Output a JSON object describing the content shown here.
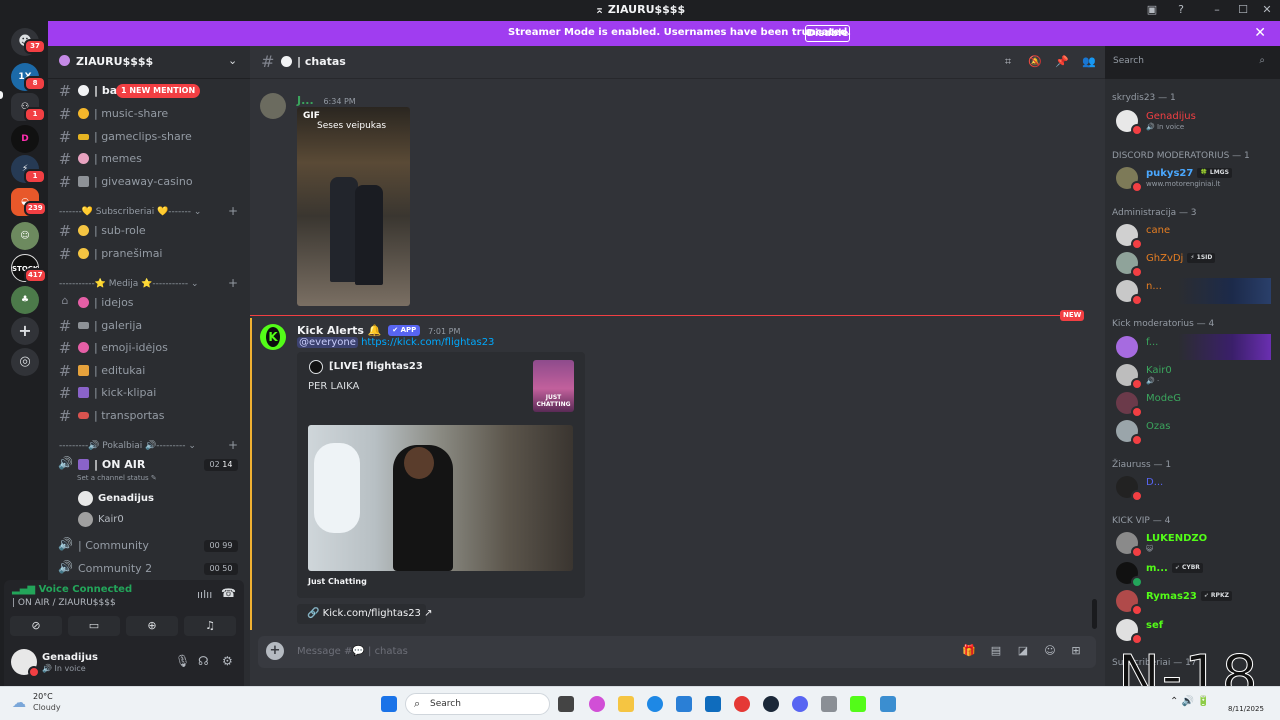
{
  "app": {
    "window_title": "ZIAURU$$$$",
    "banner_text": "Streamer Mode is enabled. Usernames have been truncated.",
    "banner_button": "Disable"
  },
  "server_rail": {
    "badges": [
      "37",
      "8",
      "1",
      "1",
      "239",
      "417"
    ]
  },
  "guild": {
    "name": "ZIAURU$$$$",
    "new_mention": "1 NEW MENTION",
    "channels_top": [
      {
        "label": "| ba"
      },
      {
        "label": "| music-share"
      },
      {
        "label": "| gameclips-share"
      },
      {
        "label": "| memes"
      },
      {
        "label": "| giveaway-casino"
      }
    ],
    "category_subscribers": "-------💛 Subscriberiai 💛------- ⌄",
    "channels_sub": [
      {
        "label": "| sub-role"
      },
      {
        "label": "| pranešimai"
      }
    ],
    "category_media": "-----------⭐ Medija ⭐----------- ⌄",
    "channels_media": [
      {
        "label": "| idejos"
      },
      {
        "label": "| galerija"
      },
      {
        "label": "| emoji-idėjos"
      },
      {
        "label": "| editukai"
      },
      {
        "label": "| kick-klipai"
      },
      {
        "label": "| transportas"
      }
    ],
    "category_voice": "---------🔊 Pokalbiai 🔊--------- ⌄",
    "voice_on_air": {
      "label": "| ON AIR",
      "count_a": "02",
      "count_b": "14",
      "status": "Set a channel status ✎"
    },
    "voice_users": [
      "Genadijus",
      "Kair0"
    ],
    "voice_community": {
      "label": "| Community",
      "count_a": "00",
      "count_b": "99"
    },
    "voice_community2": {
      "label": "Community 2",
      "count_a": "00",
      "count_b": "50"
    }
  },
  "voice_panel": {
    "status": "Voice Connected",
    "location": "| ON AIR / ZIAURU$$$$"
  },
  "user_panel": {
    "name": "Genadijus",
    "status": "In voice"
  },
  "chat": {
    "channel_name": "| chatas",
    "message_placeholder": "Message #💬 | chatas",
    "messages": [
      {
        "author": "J...",
        "time": "6:34 PM",
        "gif_tag": "GIF",
        "gif_caption": "Seses veipukas"
      },
      {
        "author": "Kick Alerts 🔔",
        "app_tag": "✔ APP",
        "time": "7:01 PM",
        "mention": "@everyone",
        "link": "https://kick.com/flightas23",
        "embed_title": "[LIVE] flightas23",
        "embed_desc": "PER LAIKA",
        "embed_thumb_text": "JUST CHATTING",
        "embed_footer": "Just Chatting",
        "link_button": "Kick.com/flightas23"
      }
    ],
    "new_label": "NEW"
  },
  "search": {
    "placeholder": "Search"
  },
  "members": {
    "groups": [
      {
        "title": "skrydis23 — 1",
        "members": [
          {
            "name": "Genadijus",
            "sub": "🔊 In voice",
            "color": "#f23f43"
          }
        ]
      },
      {
        "title": "DISCORD MODERATORIUS — 1",
        "members": [
          {
            "name": "pukys27",
            "tag": "🍀 LMGS",
            "sub": "www.motorenginiai.lt",
            "color": "#4aa8ff"
          }
        ]
      },
      {
        "title": "Administracija — 3",
        "members": [
          {
            "name": "cane",
            "color": "#e67e22"
          },
          {
            "name": "GhZvDj",
            "tag": "⚡ 1SID",
            "color": "#e67e22"
          },
          {
            "name": "n...",
            "color": "#e67e22"
          }
        ]
      },
      {
        "title": "Kick moderatorius — 4",
        "members": [
          {
            "name": "f...",
            "color": "#3ba55d"
          },
          {
            "name": "Kair0",
            "sub": "🔊 ·",
            "color": "#3ba55d"
          },
          {
            "name": "ModeG",
            "color": "#3ba55d"
          },
          {
            "name": "Ozas",
            "color": "#3ba55d"
          }
        ]
      },
      {
        "title": "Žiauruss — 1",
        "members": [
          {
            "name": "D...",
            "color": "#5865f2"
          }
        ]
      },
      {
        "title": "KICK VIP — 4",
        "members": [
          {
            "name": "LUKENDZO",
            "sub": "😺",
            "color": "#53fc18"
          },
          {
            "name": "m...",
            "tag": "➶ CYBR",
            "color": "#53fc18"
          },
          {
            "name": "Rymas23",
            "tag": "➶ RPKZ",
            "color": "#53fc18"
          },
          {
            "name": "sef",
            "color": "#53fc18"
          }
        ]
      }
    ],
    "partial_group": "Subscriberiai — 17"
  },
  "taskbar": {
    "weather_temp": "20°C",
    "weather_desc": "Cloudy",
    "search_placeholder": "Search",
    "date": "8/11/2025"
  },
  "watermark": "N-18",
  "colors": {
    "accent": "#a03df0",
    "kick_green": "#53fc18",
    "mention_red": "#f23f43"
  }
}
